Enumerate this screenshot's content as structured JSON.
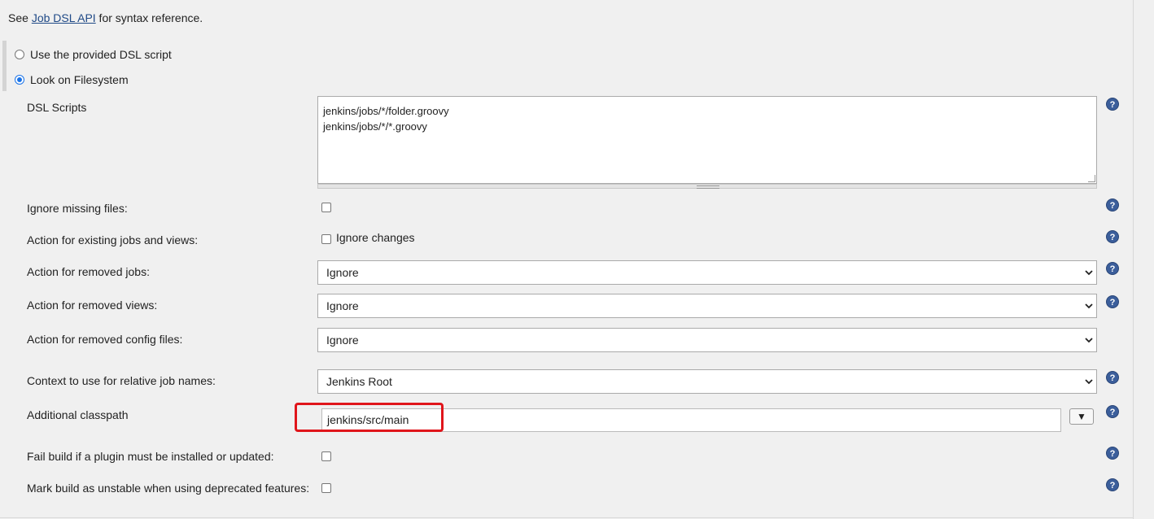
{
  "intro": {
    "prefix": "See ",
    "link": "Job DSL API",
    "suffix": " for syntax reference."
  },
  "source": {
    "options": [
      {
        "label": "Use the provided DSL script",
        "selected": false
      },
      {
        "label": "Look on Filesystem",
        "selected": true
      }
    ]
  },
  "dsl_scripts": {
    "label": "DSL Scripts",
    "lines": [
      "jenkins/jobs/*/folder.groovy",
      "jenkins/jobs/*/*.groovy"
    ]
  },
  "ignore_missing": {
    "label": "Ignore missing files:",
    "checked": false
  },
  "existing_jobs": {
    "label": "Action for existing jobs and views:",
    "checkbox_label": "Ignore changes",
    "checked": false
  },
  "removed_jobs": {
    "label": "Action for removed jobs:",
    "value": "Ignore"
  },
  "removed_views": {
    "label": "Action for removed views:",
    "value": "Ignore"
  },
  "removed_config": {
    "label": "Action for removed config files:",
    "value": "Ignore"
  },
  "context": {
    "label": "Context to use for relative job names:",
    "value": "Jenkins Root"
  },
  "classpath": {
    "label": "Additional classpath",
    "value": "jenkins/src/main",
    "dropdown_glyph": "▼"
  },
  "fail_build": {
    "label": "Fail build if a plugin must be installed or updated:",
    "checked": false
  },
  "mark_unstable": {
    "label": "Mark build as unstable when using deprecated features:",
    "checked": false
  },
  "help_glyph": "?",
  "colors": {
    "highlight": "#e0151b",
    "help": "#3b5e9b",
    "radio_selected": "#1a73e8"
  }
}
